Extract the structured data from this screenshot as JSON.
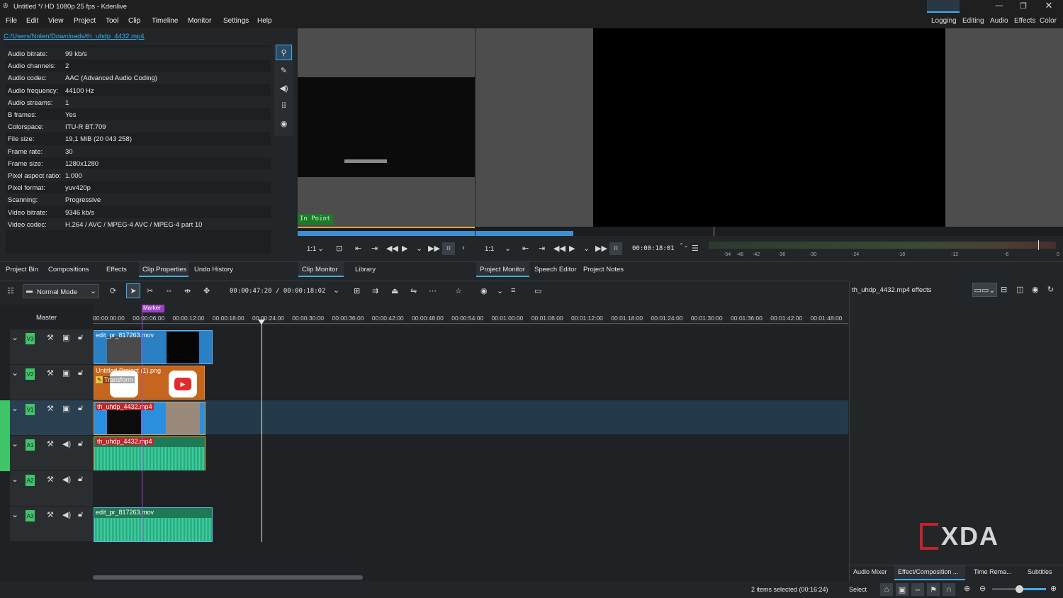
{
  "window": {
    "title": "Untitled */ HD 1080p 25 fps - Kdenlive"
  },
  "menu": [
    "File",
    "Edit",
    "View",
    "Project",
    "Tool",
    "Clip",
    "Timeline",
    "Monitor",
    "Settings",
    "Help"
  ],
  "workspaces": [
    "Logging",
    "Editing",
    "Audio",
    "Effects",
    "Color"
  ],
  "clip_path": "C:/Users/Nolen/Downloads/th_uhdp_4432.mp4",
  "properties": [
    {
      "k": "Audio bitrate:",
      "v": "99 kb/s"
    },
    {
      "k": "Audio channels:",
      "v": "2"
    },
    {
      "k": "Audio codec:",
      "v": "AAC (Advanced Audio Coding)"
    },
    {
      "k": "Audio frequency:",
      "v": "44100 Hz"
    },
    {
      "k": "Audio streams:",
      "v": "1"
    },
    {
      "k": "B frames:",
      "v": "Yes"
    },
    {
      "k": "Colorspace:",
      "v": "ITU-R BT.709"
    },
    {
      "k": "File size:",
      "v": "19,1 MiB (20 043 258)"
    },
    {
      "k": "Frame rate:",
      "v": "30"
    },
    {
      "k": "Frame size:",
      "v": "1280x1280"
    },
    {
      "k": "Pixel aspect ratio:",
      "v": "1.000"
    },
    {
      "k": "Pixel format:",
      "v": "yuv420p"
    },
    {
      "k": "Scanning:",
      "v": "Progressive"
    },
    {
      "k": "Video bitrate:",
      "v": "9346 kb/s"
    },
    {
      "k": "Video codec:",
      "v": "H.264 / AVC / MPEG-4 AVC / MPEG-4 part 10"
    }
  ],
  "left_tabs": [
    "Project Bin",
    "Compositions",
    "Effects",
    "Clip Properties",
    "Undo History"
  ],
  "clip_monitor": {
    "in_point": "In Point",
    "zoom": "1:1",
    "tabs": [
      "Clip Monitor",
      "Library"
    ]
  },
  "project_monitor": {
    "zoom": "1:1",
    "timecode": "00:00:18:01",
    "tabs": [
      "Project Monitor",
      "Speech Editor",
      "Project Notes"
    ]
  },
  "meter_ticks": [
    "-54",
    "-48",
    "-42",
    "-36",
    "-30",
    "-24",
    "-18",
    "-12",
    "-6",
    "0"
  ],
  "timeline": {
    "mode": "Normal Mode",
    "timecode": "00:00:47:20 / 00:00:18:02",
    "master": "Master",
    "marker": "Marker",
    "ruler": [
      "00:00:00:00",
      "00:00:06:00",
      "00:00:12:00",
      "00:00:18:00",
      "00:00:24:00",
      "00:00:30:00",
      "00:00:36:00",
      "00:00:42:00",
      "00:00:48:00",
      "00:00:54:00",
      "00:01:00:00",
      "00:01:06:00",
      "00:01:12:00",
      "00:01:18:00",
      "00:01:24:00",
      "00:01:30:00",
      "00:01:36:00",
      "00:01:42:00",
      "00:01:48:00"
    ],
    "tracks": [
      {
        "label": "V3"
      },
      {
        "label": "V2"
      },
      {
        "label": "V1"
      },
      {
        "label": "A1"
      },
      {
        "label": "A2"
      },
      {
        "label": "A3"
      }
    ],
    "clips": {
      "v3": "edit_pr_817263.mov",
      "v2": "Untitled Project (1).png",
      "v2_effect": "Transform",
      "v1": "th_uhdp_4432.mp4",
      "a1": "th_uhdp_4432.mp4",
      "a3": "edit_pr_817263.mov"
    }
  },
  "effects_panel": {
    "title": "th_uhdp_4432.mp4 effects",
    "tabs": [
      "Audio Mixer",
      "Effect/Composition ...",
      "Time Rema...",
      "Subtitles"
    ]
  },
  "status": {
    "selected": "2 items selected (00:16:24)",
    "tool": "Select"
  },
  "watermark": "XDA"
}
